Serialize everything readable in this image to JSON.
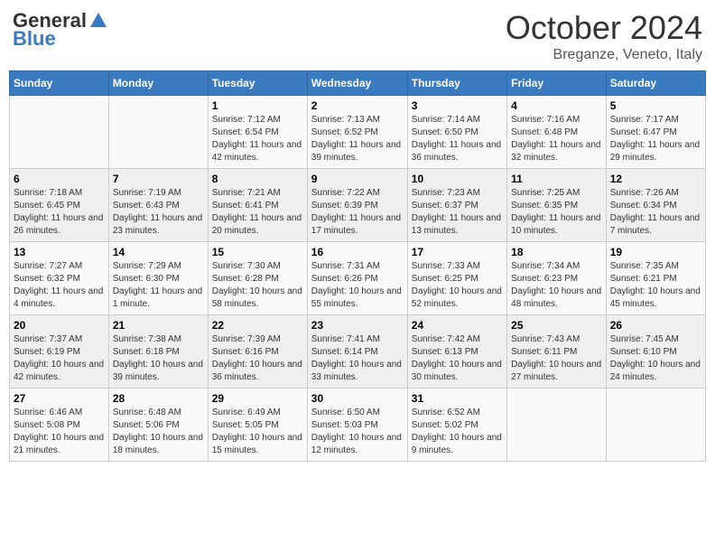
{
  "header": {
    "logo_general": "General",
    "logo_blue": "Blue",
    "month_title": "October 2024",
    "subtitle": "Breganze, Veneto, Italy"
  },
  "days_of_week": [
    "Sunday",
    "Monday",
    "Tuesday",
    "Wednesday",
    "Thursday",
    "Friday",
    "Saturday"
  ],
  "weeks": [
    [
      {
        "day": "",
        "sunrise": "",
        "sunset": "",
        "daylight": ""
      },
      {
        "day": "",
        "sunrise": "",
        "sunset": "",
        "daylight": ""
      },
      {
        "day": "1",
        "sunrise": "Sunrise: 7:12 AM",
        "sunset": "Sunset: 6:54 PM",
        "daylight": "Daylight: 11 hours and 42 minutes."
      },
      {
        "day": "2",
        "sunrise": "Sunrise: 7:13 AM",
        "sunset": "Sunset: 6:52 PM",
        "daylight": "Daylight: 11 hours and 39 minutes."
      },
      {
        "day": "3",
        "sunrise": "Sunrise: 7:14 AM",
        "sunset": "Sunset: 6:50 PM",
        "daylight": "Daylight: 11 hours and 36 minutes."
      },
      {
        "day": "4",
        "sunrise": "Sunrise: 7:16 AM",
        "sunset": "Sunset: 6:48 PM",
        "daylight": "Daylight: 11 hours and 32 minutes."
      },
      {
        "day": "5",
        "sunrise": "Sunrise: 7:17 AM",
        "sunset": "Sunset: 6:47 PM",
        "daylight": "Daylight: 11 hours and 29 minutes."
      }
    ],
    [
      {
        "day": "6",
        "sunrise": "Sunrise: 7:18 AM",
        "sunset": "Sunset: 6:45 PM",
        "daylight": "Daylight: 11 hours and 26 minutes."
      },
      {
        "day": "7",
        "sunrise": "Sunrise: 7:19 AM",
        "sunset": "Sunset: 6:43 PM",
        "daylight": "Daylight: 11 hours and 23 minutes."
      },
      {
        "day": "8",
        "sunrise": "Sunrise: 7:21 AM",
        "sunset": "Sunset: 6:41 PM",
        "daylight": "Daylight: 11 hours and 20 minutes."
      },
      {
        "day": "9",
        "sunrise": "Sunrise: 7:22 AM",
        "sunset": "Sunset: 6:39 PM",
        "daylight": "Daylight: 11 hours and 17 minutes."
      },
      {
        "day": "10",
        "sunrise": "Sunrise: 7:23 AM",
        "sunset": "Sunset: 6:37 PM",
        "daylight": "Daylight: 11 hours and 13 minutes."
      },
      {
        "day": "11",
        "sunrise": "Sunrise: 7:25 AM",
        "sunset": "Sunset: 6:35 PM",
        "daylight": "Daylight: 11 hours and 10 minutes."
      },
      {
        "day": "12",
        "sunrise": "Sunrise: 7:26 AM",
        "sunset": "Sunset: 6:34 PM",
        "daylight": "Daylight: 11 hours and 7 minutes."
      }
    ],
    [
      {
        "day": "13",
        "sunrise": "Sunrise: 7:27 AM",
        "sunset": "Sunset: 6:32 PM",
        "daylight": "Daylight: 11 hours and 4 minutes."
      },
      {
        "day": "14",
        "sunrise": "Sunrise: 7:29 AM",
        "sunset": "Sunset: 6:30 PM",
        "daylight": "Daylight: 11 hours and 1 minute."
      },
      {
        "day": "15",
        "sunrise": "Sunrise: 7:30 AM",
        "sunset": "Sunset: 6:28 PM",
        "daylight": "Daylight: 10 hours and 58 minutes."
      },
      {
        "day": "16",
        "sunrise": "Sunrise: 7:31 AM",
        "sunset": "Sunset: 6:26 PM",
        "daylight": "Daylight: 10 hours and 55 minutes."
      },
      {
        "day": "17",
        "sunrise": "Sunrise: 7:33 AM",
        "sunset": "Sunset: 6:25 PM",
        "daylight": "Daylight: 10 hours and 52 minutes."
      },
      {
        "day": "18",
        "sunrise": "Sunrise: 7:34 AM",
        "sunset": "Sunset: 6:23 PM",
        "daylight": "Daylight: 10 hours and 48 minutes."
      },
      {
        "day": "19",
        "sunrise": "Sunrise: 7:35 AM",
        "sunset": "Sunset: 6:21 PM",
        "daylight": "Daylight: 10 hours and 45 minutes."
      }
    ],
    [
      {
        "day": "20",
        "sunrise": "Sunrise: 7:37 AM",
        "sunset": "Sunset: 6:19 PM",
        "daylight": "Daylight: 10 hours and 42 minutes."
      },
      {
        "day": "21",
        "sunrise": "Sunrise: 7:38 AM",
        "sunset": "Sunset: 6:18 PM",
        "daylight": "Daylight: 10 hours and 39 minutes."
      },
      {
        "day": "22",
        "sunrise": "Sunrise: 7:39 AM",
        "sunset": "Sunset: 6:16 PM",
        "daylight": "Daylight: 10 hours and 36 minutes."
      },
      {
        "day": "23",
        "sunrise": "Sunrise: 7:41 AM",
        "sunset": "Sunset: 6:14 PM",
        "daylight": "Daylight: 10 hours and 33 minutes."
      },
      {
        "day": "24",
        "sunrise": "Sunrise: 7:42 AM",
        "sunset": "Sunset: 6:13 PM",
        "daylight": "Daylight: 10 hours and 30 minutes."
      },
      {
        "day": "25",
        "sunrise": "Sunrise: 7:43 AM",
        "sunset": "Sunset: 6:11 PM",
        "daylight": "Daylight: 10 hours and 27 minutes."
      },
      {
        "day": "26",
        "sunrise": "Sunrise: 7:45 AM",
        "sunset": "Sunset: 6:10 PM",
        "daylight": "Daylight: 10 hours and 24 minutes."
      }
    ],
    [
      {
        "day": "27",
        "sunrise": "Sunrise: 6:46 AM",
        "sunset": "Sunset: 5:08 PM",
        "daylight": "Daylight: 10 hours and 21 minutes."
      },
      {
        "day": "28",
        "sunrise": "Sunrise: 6:48 AM",
        "sunset": "Sunset: 5:06 PM",
        "daylight": "Daylight: 10 hours and 18 minutes."
      },
      {
        "day": "29",
        "sunrise": "Sunrise: 6:49 AM",
        "sunset": "Sunset: 5:05 PM",
        "daylight": "Daylight: 10 hours and 15 minutes."
      },
      {
        "day": "30",
        "sunrise": "Sunrise: 6:50 AM",
        "sunset": "Sunset: 5:03 PM",
        "daylight": "Daylight: 10 hours and 12 minutes."
      },
      {
        "day": "31",
        "sunrise": "Sunrise: 6:52 AM",
        "sunset": "Sunset: 5:02 PM",
        "daylight": "Daylight: 10 hours and 9 minutes."
      },
      {
        "day": "",
        "sunrise": "",
        "sunset": "",
        "daylight": ""
      },
      {
        "day": "",
        "sunrise": "",
        "sunset": "",
        "daylight": ""
      }
    ]
  ]
}
